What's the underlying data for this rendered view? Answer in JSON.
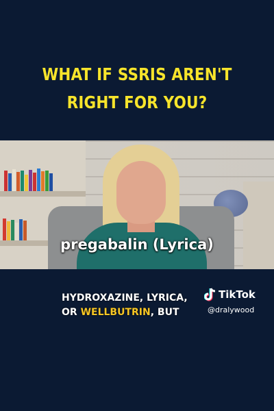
{
  "headline": {
    "line1": "WHAT IF SSRIS AREN'T",
    "line2": "RIGHT FOR YOU?"
  },
  "video": {
    "caption": "pregabalin (Lyrica)"
  },
  "subtitle": {
    "line1": "HYDROXAZINE, LYRICA,",
    "line2_part1": "OR ",
    "line2_highlight": "WELLBUTRIN",
    "line2_part2": ", BUT"
  },
  "watermark": {
    "brand": "TikTok",
    "handle": "@dralywood"
  },
  "colors": {
    "background": "#0b1a33",
    "headline": "#f7e42b",
    "highlight": "#f7c624"
  }
}
